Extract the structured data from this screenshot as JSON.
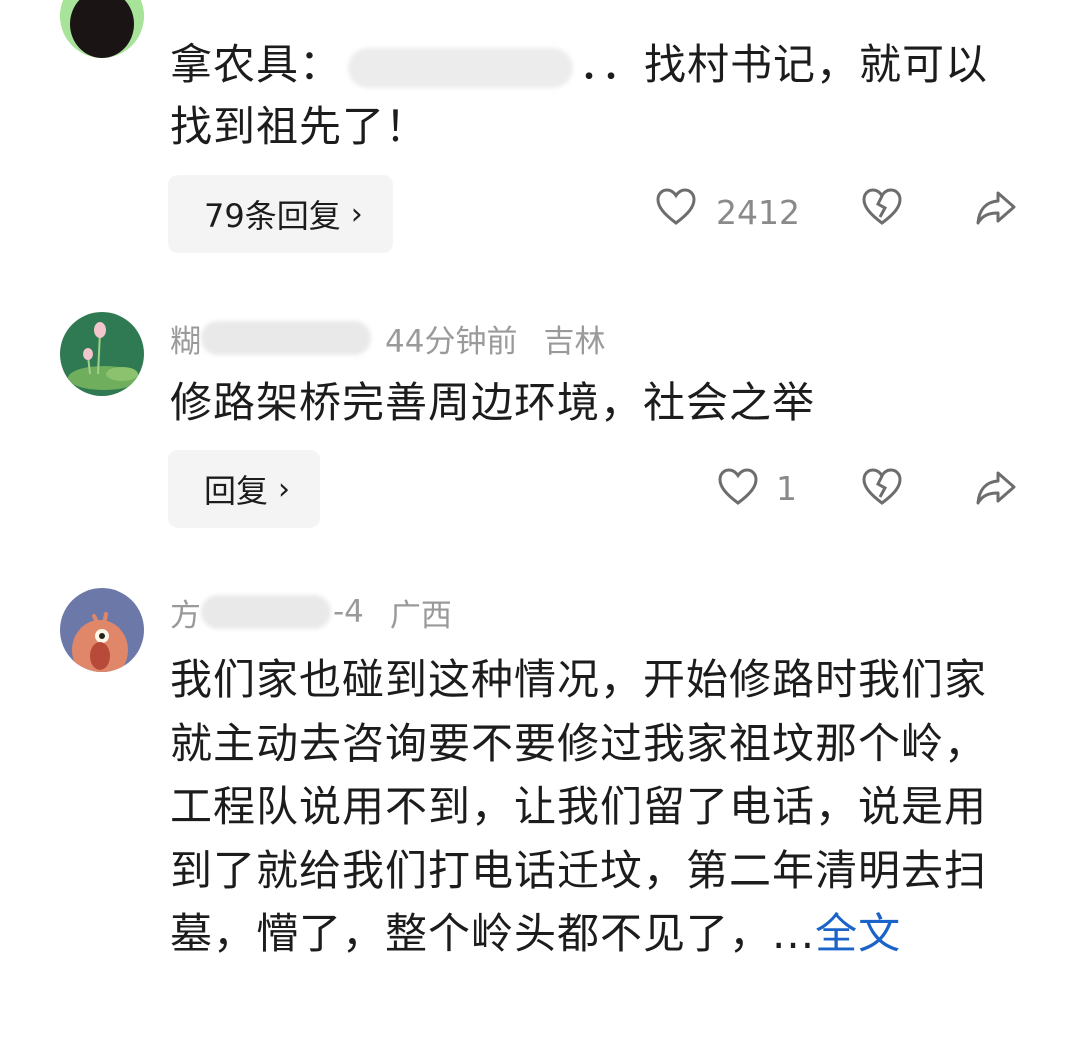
{
  "comments": [
    {
      "body_prefix": "拿农具：",
      "body_suffix": "．．找村书记，就可以找到祖先了！",
      "reply_label": "79条回复",
      "like_count": "2412"
    },
    {
      "username_visible": "糊",
      "time": "44分钟前",
      "location": "吉林",
      "body": "修路架桥完善周边环境，社会之举",
      "reply_label": "回复",
      "like_count": "1"
    },
    {
      "username_visible": "方",
      "time": "-4",
      "location": "广西",
      "body": "我们家也碰到这种情况，开始修路时我们家就主动去咨询要不要修过我家祖坟那个岭，工程队说用不到，让我们留了电话，说是用到了就给我们打电话迁坟，第二年清明去扫墓，懵了，整个岭头都不见了，...",
      "more_label": "全文"
    }
  ],
  "icons": {
    "like": "heart-outline-icon",
    "dislike": "broken-heart-icon",
    "share": "share-arrow-icon",
    "chevron": "chevron-right-icon"
  },
  "colors": {
    "link": "#1a63c9",
    "meta": "#9a9a9a",
    "button_bg": "#f4f4f4"
  }
}
